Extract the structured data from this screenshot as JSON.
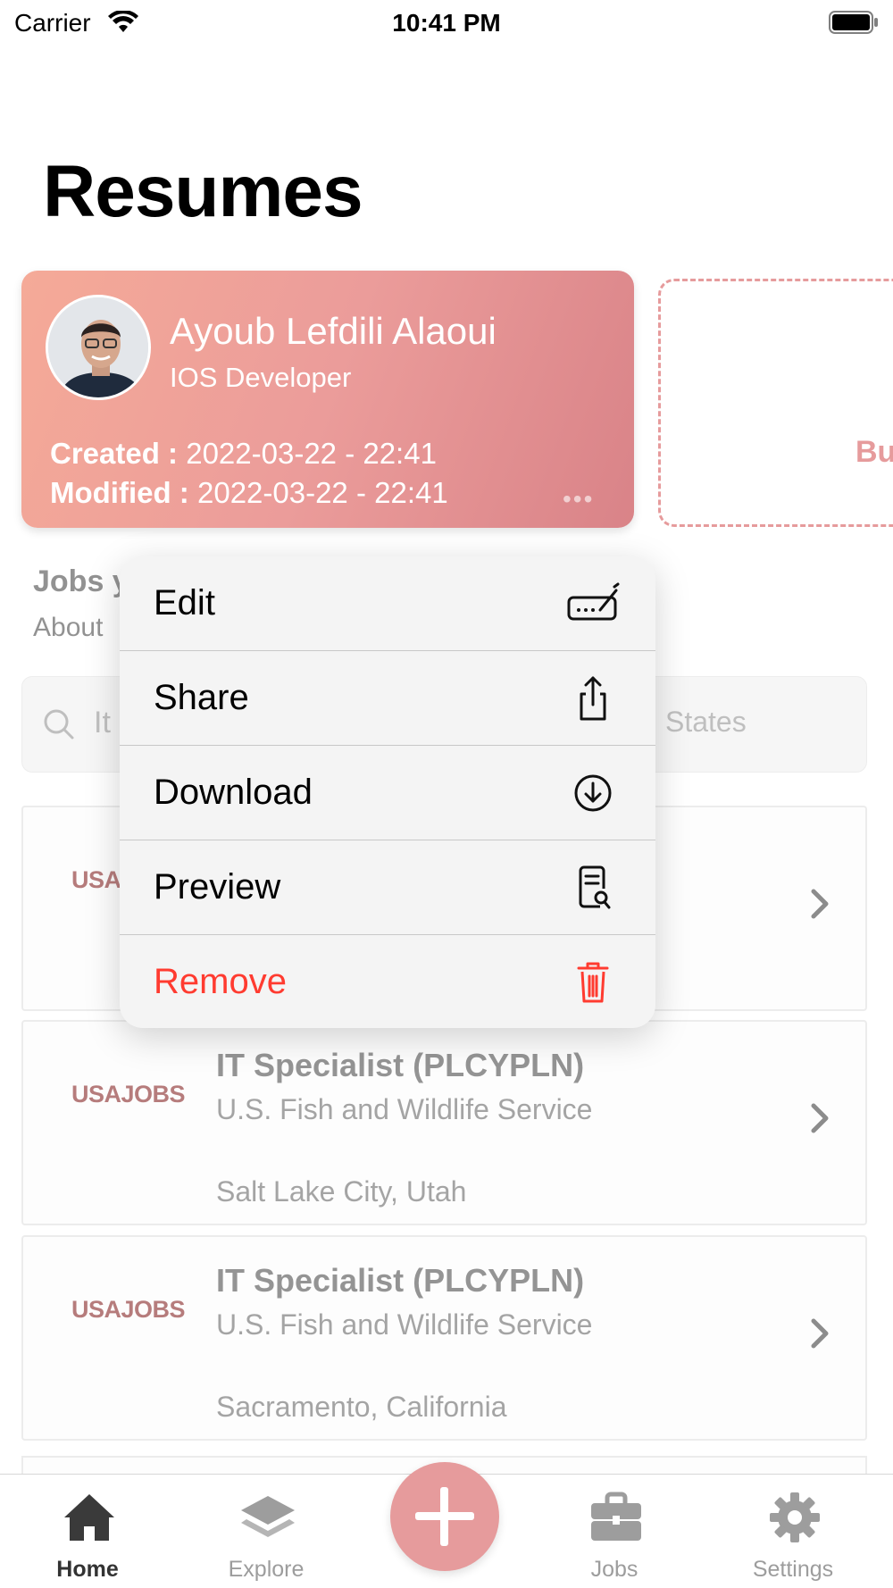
{
  "status_bar": {
    "carrier": "Carrier",
    "time": "10:41 PM"
  },
  "page": {
    "title": "Resumes"
  },
  "resume": {
    "name": "Ayoub Lefdili Alaoui",
    "role": "IOS Developer",
    "created_label": "Created :",
    "created_value": "2022-03-22 - 22:41",
    "modified_label": "Modified :",
    "modified_value": "2022-03-22 - 22:41",
    "more": "•••"
  },
  "add_card": {
    "label": "Bu"
  },
  "jobs_section": {
    "title": "Jobs y",
    "subtitle": "About"
  },
  "search": {
    "left_text": "It",
    "right_text": "States"
  },
  "jobs": [
    {
      "logo": "USAJ",
      "title": "",
      "agency": "",
      "location": ""
    },
    {
      "logo": "USAJOBS",
      "title": "IT Specialist (PLCYPLN)",
      "agency": "U.S. Fish and Wildlife Service",
      "location": "Salt Lake City, Utah"
    },
    {
      "logo": "USAJOBS",
      "title": "IT Specialist (PLCYPLN)",
      "agency": "U.S. Fish and Wildlife Service",
      "location": "Sacramento, California"
    }
  ],
  "context_menu": {
    "items": [
      {
        "label": "Edit",
        "icon": "signature-icon"
      },
      {
        "label": "Share",
        "icon": "share-icon"
      },
      {
        "label": "Download",
        "icon": "download-icon"
      },
      {
        "label": "Preview",
        "icon": "preview-icon"
      },
      {
        "label": "Remove",
        "icon": "trash-icon",
        "destructive": true
      }
    ]
  },
  "tab_bar": {
    "tabs": [
      {
        "label": "Home",
        "icon": "home-icon",
        "active": true
      },
      {
        "label": "Explore",
        "icon": "layers-icon"
      },
      {
        "label": "Jobs",
        "icon": "briefcase-icon"
      },
      {
        "label": "Settings",
        "icon": "gear-icon"
      }
    ],
    "fab_icon": "plus-icon"
  },
  "colors": {
    "accent": "#e69b9c",
    "destructive": "#ff3b30",
    "logo": "#7a1111"
  }
}
